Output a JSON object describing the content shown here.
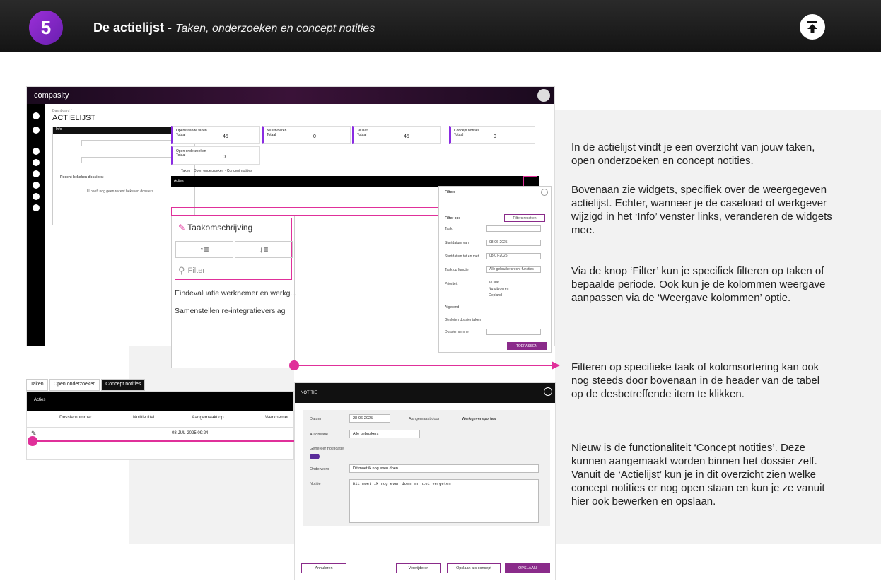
{
  "header": {
    "step_number": "5",
    "title_bold": "De actielijst",
    "title_separator": " - ",
    "title_italic": "Taken, onderzoeken en concept notities",
    "top_icon": "arrow-up-to-line-icon"
  },
  "screenshot_main": {
    "brand": "compasity",
    "breadcrumb": "Dashboard /",
    "page_title": "ACTIELIJST",
    "info_panel_title": "Info",
    "recent_title": "Recent bekeken dossiers:",
    "recent_empty": "U heeft nog geen recent bekeken dossiers.",
    "widgets": [
      {
        "title": "Openstaande taken",
        "sub": "Totaal",
        "value": "45"
      },
      {
        "title": "Nu uitvoeren",
        "sub": "Totaal",
        "value": "0"
      },
      {
        "title": "Te laat",
        "sub": "Totaal",
        "value": "45"
      },
      {
        "title": "Concept notities",
        "sub": "Totaal",
        "value": "0"
      },
      {
        "title": "Open onderzoeken",
        "sub": "Totaal",
        "value": "0"
      }
    ],
    "tabs": [
      "Taken",
      "Open onderzoeken",
      "Concept notities"
    ],
    "table_actions": "Acties",
    "column_panel": {
      "header": "Taakomschrijving",
      "filter_placeholder": "Filter",
      "items": [
        "Eindevaluatie werknemer en werkg...",
        "Samenstellen re-integratieverslag"
      ]
    },
    "filters": {
      "title": "Filters",
      "filter_on": "Filter op:",
      "reset": "Filters resetten",
      "fields": [
        {
          "label": "Taak",
          "value": ""
        },
        {
          "label": "Startdatum van",
          "value": "08-06-2025"
        },
        {
          "label": "Startdatum tot en met",
          "value": "08-07-2025"
        },
        {
          "label": "Taak op functie",
          "value": "Alle gebruikersrecht functies"
        }
      ],
      "priority_label": "Prioriteit",
      "priorities": [
        "Te laat",
        "Nu uitvoeren",
        "Gepland"
      ],
      "done_label": "Afgerond",
      "closed_label": "Gesloten dossier taken",
      "dossier_label": "Dossiernummer",
      "apply": "TOEPASSEN"
    }
  },
  "concept": {
    "tabs": [
      "Taken",
      "Open onderzoeken",
      "Concept notities"
    ],
    "actions": "Acties",
    "columns": [
      "Dossiernummer",
      "Notitie titel",
      "Aangemaakt op",
      "Werknemer"
    ],
    "row": {
      "title": "-",
      "created": "08-JUL-2025 09:24"
    }
  },
  "note": {
    "title": "NOTITIE",
    "datum_label": "Datum",
    "datum_value": "28-06-2025",
    "created_by_label": "Aangemaakt door",
    "created_by_value": "Werkgeversportaal",
    "auth_label": "Autorisatie",
    "auth_value": "Alle gebruikers",
    "notify_label": "Genereer notificatie",
    "subject_label": "Onderwerp",
    "subject_value": "Dit moet ik nog even doen",
    "note_label": "Notitie",
    "note_value": "Dit moet ik nog even doen en niet vergeten",
    "buttons": {
      "cancel": "Annuleren",
      "delete": "Verwijderen",
      "save_concept": "Opslaan als concept",
      "save": "OPSLAAN"
    }
  },
  "text": {
    "p1": "In de actielijst vindt je een overzicht van jouw taken, open onderzoeken en concept notities.",
    "p2": "Bovenaan zie widgets, specifiek over de weergegeven actielijst. Echter, wanneer je de caseload of werkgever wijzigd in het ‘Info’ venster links, veranderen de widgets mee.",
    "p3": "Via de knop ‘Filter’ kun je specifiek filteren op taken of bepaalde periode. Ook kun je de kolommen weergave aanpassen via de ‘Weergave kolommen’ optie.",
    "p4": "Filteren op specifieke taak of kolomsortering kan ook nog steeds door bovenaan in de header van de tabel op de desbetreffende item te klikken.",
    "p5": "Nieuw is de functionaliteit ‘Concept notities’. Deze kunnen aangemaakt worden binnen het dossier zelf. Vanuit de ‘Actielijst’ kun je in dit overzicht zien welke concept notities er nog open staan en kun je ze vanuit hier ook bewerken en opslaan."
  },
  "colors": {
    "accent": "#e0309a",
    "brand": "#8a2b8a",
    "step": "#8a2be2"
  }
}
